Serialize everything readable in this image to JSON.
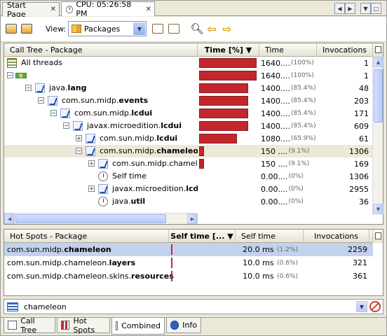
{
  "tabs": [
    {
      "label": "Start Page",
      "close": "✕"
    },
    {
      "label": "CPU: 05:26:58 PM",
      "close": "✕"
    }
  ],
  "toolbar": {
    "view_label": "View:",
    "view_value": "Packages"
  },
  "call_tree": {
    "headers": [
      "Call Tree - Package",
      "Time [%] ▼",
      "Time",
      "Invocations"
    ],
    "rows": [
      {
        "name": "All threads",
        "bold": "",
        "time": "1640....",
        "pct": "(100%)",
        "inv": "1",
        "bar": 1.0
      },
      {
        "name": "",
        "bold": "",
        "time": "1640....",
        "pct": "(100%)",
        "inv": "1",
        "bar": 1.0
      },
      {
        "name": "java.",
        "bold": "lang",
        "time": "1400....",
        "pct": "(85.4%)",
        "inv": "48",
        "bar": 0.854
      },
      {
        "name": "com.sun.midp.",
        "bold": "events",
        "time": "1400....",
        "pct": "(85.4%)",
        "inv": "203",
        "bar": 0.854
      },
      {
        "name": "com.sun.midp.",
        "bold": "lcdui",
        "time": "1400....",
        "pct": "(85.4%)",
        "inv": "171",
        "bar": 0.854
      },
      {
        "name": "javax.microedition.",
        "bold": "lcdui",
        "time": "1400....",
        "pct": "(85.4%)",
        "inv": "609",
        "bar": 0.854
      },
      {
        "name": "com.sun.midp.",
        "bold": "lcdui",
        "time": "1080....",
        "pct": "(65.9%)",
        "inv": "61",
        "bar": 0.659
      },
      {
        "name": "com.sun.midp.",
        "bold": "chameleon",
        "time": "150 ....",
        "pct": "(9.1%)",
        "inv": "1306",
        "bar": 0.091
      },
      {
        "name": "com.sun.midp.chameleor",
        "bold": "",
        "time": "150 ....",
        "pct": "(9.1%)",
        "inv": "169",
        "bar": 0.091
      },
      {
        "name": "Self time",
        "bold": "",
        "time": "0.00....",
        "pct": "(0%)",
        "inv": "1306",
        "bar": 0
      },
      {
        "name": "javax.microedition.",
        "bold": "lcdui",
        "time": "0.00....",
        "pct": "(0%)",
        "inv": "2955",
        "bar": 0
      },
      {
        "name": "java.",
        "bold": "util",
        "time": "0.00....",
        "pct": "(0%)",
        "inv": "36",
        "bar": 0
      }
    ]
  },
  "hot_spots": {
    "headers": [
      "Hot Spots - Package",
      "Self time [... ▼",
      "Self time",
      "Invocations"
    ],
    "rows": [
      {
        "name": "com.sun.midp.",
        "bold": "chameleon",
        "time": "20.0 ms",
        "pct": "(1.2%)",
        "inv": "2259"
      },
      {
        "name": "com.sun.midp.chameleon.",
        "bold": "layers",
        "time": "10.0 ms",
        "pct": "(0.6%)",
        "inv": "321"
      },
      {
        "name": "com.sun.midp.chameleon.skins.",
        "bold": "resources",
        "time": "10.0 ms",
        "pct": "(0.6%)",
        "inv": "361"
      }
    ]
  },
  "filter": {
    "value": "chameleon"
  },
  "bottom_tabs": [
    "Call Tree",
    "Hot Spots",
    "Combined",
    "Info"
  ],
  "colors": {
    "bar": "#c1272d",
    "selection": "#c3d2ec",
    "highlight": "#ece9d8"
  },
  "icons": [
    "save-snapshot-icon",
    "export-icon",
    "find-icon",
    "back-icon",
    "forward-icon",
    "package-icon",
    "clock-icon",
    "thread-icon"
  ]
}
